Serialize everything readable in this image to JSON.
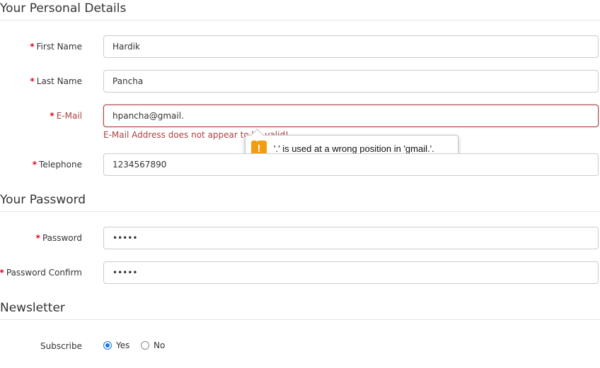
{
  "sections": {
    "personal": "Your Personal Details",
    "password": "Your Password",
    "newsletter": "Newsletter"
  },
  "fields": {
    "first_name": {
      "label": "First Name",
      "value": "Hardik"
    },
    "last_name": {
      "label": "Last Name",
      "value": "Pancha"
    },
    "email": {
      "label": "E-Mail",
      "value": "hpancha@gmail."
    },
    "telephone": {
      "label": "Telephone",
      "value": "1234567890"
    },
    "password": {
      "label": "Password",
      "value": "•••••"
    },
    "password_confirm": {
      "label": "Password Confirm",
      "value": "•••••"
    }
  },
  "required_marker": "*",
  "email_error": "E-Mail Address does not appear to be valid!",
  "tooltip": {
    "icon": "!",
    "text": "'.' is used at a wrong position in 'gmail.'."
  },
  "newsletter": {
    "label": "Subscribe",
    "options": [
      {
        "label": "Yes",
        "checked": true
      },
      {
        "label": "No",
        "checked": false
      }
    ]
  },
  "colors": {
    "required": "#e0001a",
    "error": "#a94442",
    "warning": "#f39c12",
    "radio": "#1a73e8"
  }
}
